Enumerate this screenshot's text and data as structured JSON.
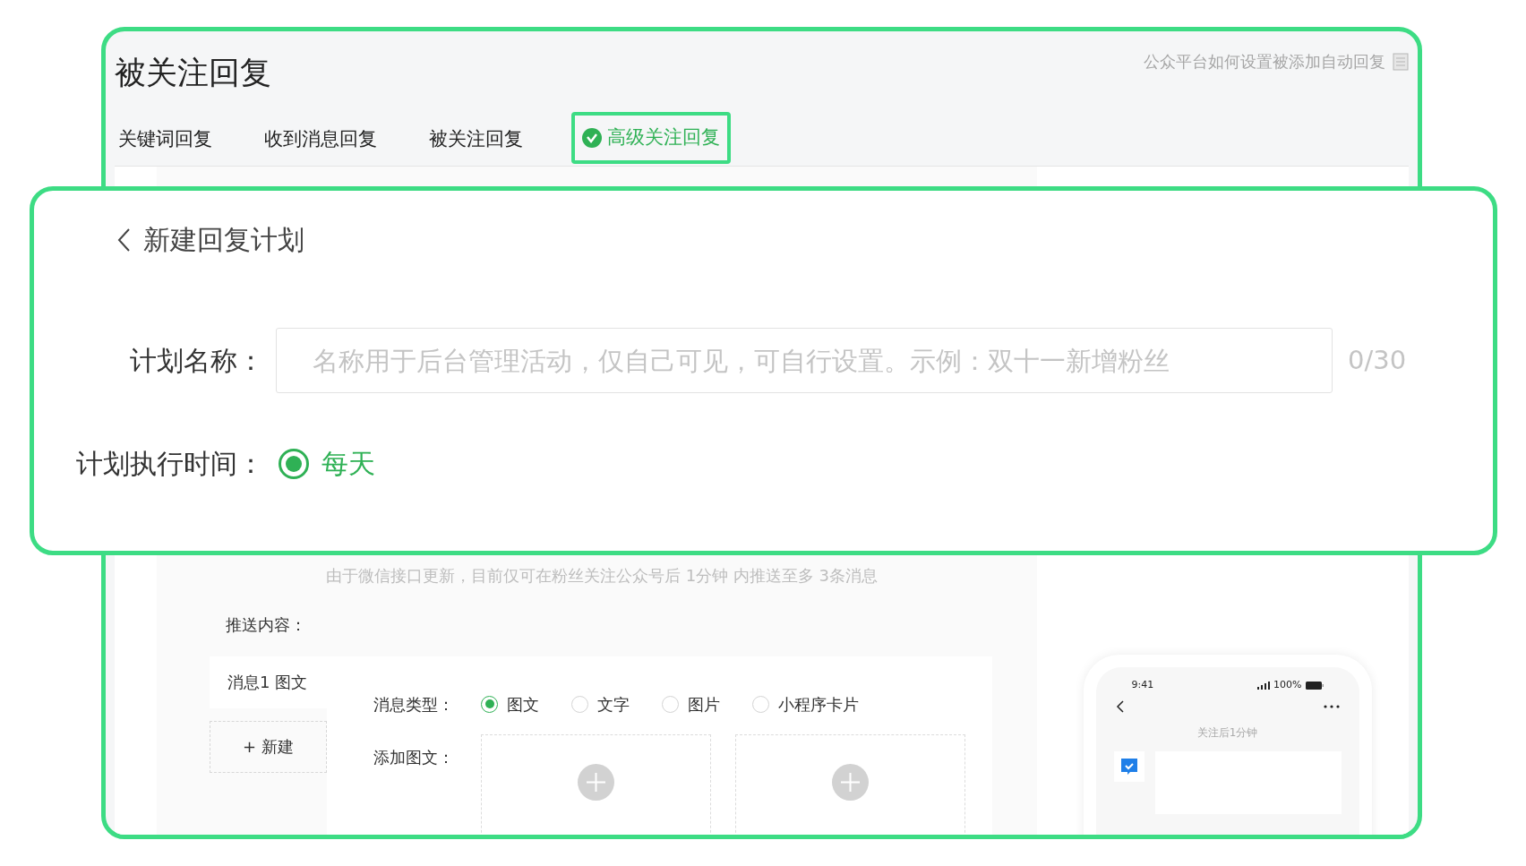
{
  "page_title": "被关注回复",
  "help_link": "公众平台如何设置被添加自动回复",
  "tabs": [
    {
      "label": "关键词回复",
      "selected": false,
      "highlighted": false
    },
    {
      "label": "收到消息回复",
      "selected": false,
      "highlighted": false
    },
    {
      "label": "被关注回复",
      "selected": false,
      "highlighted": false
    },
    {
      "label": "高级关注回复",
      "selected": true,
      "highlighted": true
    }
  ],
  "callout": {
    "back_title": "新建回复计划",
    "plan_name": {
      "label": "计划名称：",
      "placeholder": "名称用于后台管理活动，仅自己可见，可自行设置。示例：双十一新增粉丝",
      "counter": "0/30"
    },
    "schedule": {
      "label": "计划执行时间：",
      "options": [
        {
          "label": "每天",
          "selected": true
        }
      ]
    }
  },
  "notice": "由于微信接口更新，目前仅可在粉丝关注公众号后 1分钟 内推送至多 3条消息",
  "push_content_label": "推送内容：",
  "messages": [
    {
      "label": "消息1 图文",
      "selected": true
    }
  ],
  "new_button": "+ 新建",
  "message_type": {
    "label": "消息类型：",
    "options": [
      {
        "label": "图文",
        "selected": true
      },
      {
        "label": "文字",
        "selected": false
      },
      {
        "label": "图片",
        "selected": false
      },
      {
        "label": "小程序卡片",
        "selected": false
      }
    ]
  },
  "add_article": {
    "label": "添加图文：",
    "slots": [
      {
        "kind": "add"
      },
      {
        "kind": "add"
      }
    ]
  },
  "phone": {
    "time": "9:41",
    "battery": "100%",
    "caption": "关注后1分钟"
  }
}
